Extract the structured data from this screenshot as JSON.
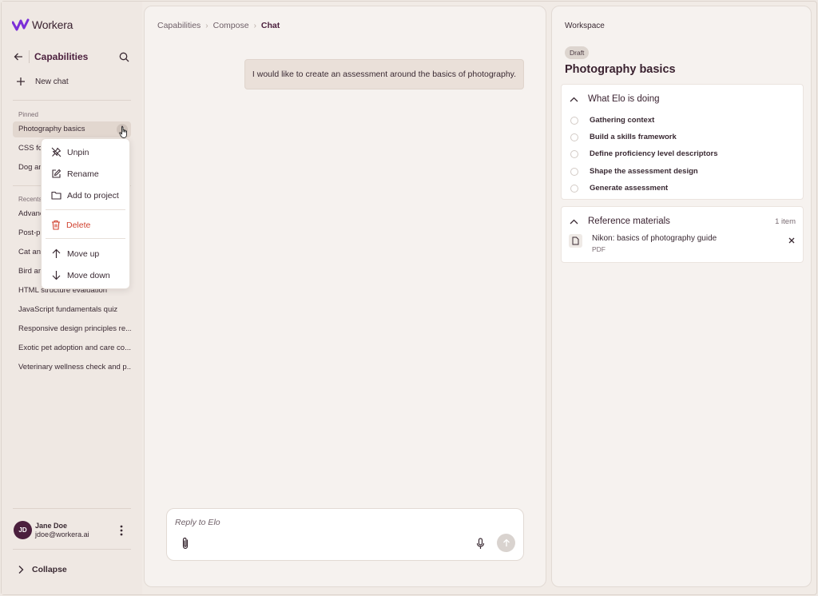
{
  "app": {
    "brand": "Workera"
  },
  "sidebar": {
    "title": "Capabilities",
    "new_chat": "New chat",
    "pinned_label": "Pinned",
    "pinned": [
      {
        "label": "Photography basics"
      },
      {
        "label": "CSS fou"
      },
      {
        "label": "Dog an"
      }
    ],
    "recents_label": "Recents",
    "recents": [
      {
        "label": "Advanc"
      },
      {
        "label": "Post-pr"
      },
      {
        "label": "Cat and"
      },
      {
        "label": "Bird an"
      },
      {
        "label": "HTML structure evaluation"
      },
      {
        "label": "JavaScript fundamentals quiz"
      },
      {
        "label": "Responsive design principles re..."
      },
      {
        "label": "Exotic pet adoption and care co..."
      },
      {
        "label": "Veterinary wellness check and p..."
      }
    ],
    "user": {
      "initials": "JD",
      "name": "Jane Doe",
      "email": "jdoe@workera.ai"
    },
    "collapse": "Collapse"
  },
  "context_menu": {
    "unpin": "Unpin",
    "rename": "Rename",
    "add_to_project": "Add to project",
    "delete": "Delete",
    "move_up": "Move up",
    "move_down": "Move down"
  },
  "main": {
    "breadcrumbs": [
      "Capabilities",
      "Compose",
      "Chat"
    ],
    "message": "I would like to create an assessment around the basics of photography.",
    "composer_placeholder": "Reply to Elo"
  },
  "workspace": {
    "label": "Workspace",
    "badge": "Draft",
    "title": "Photography basics",
    "doing": {
      "heading": "What Elo is doing",
      "steps": [
        "Gathering context",
        "Build a skills framework",
        "Define proficiency level descriptors",
        "Shape the assessment design",
        "Generate assessment"
      ]
    },
    "references": {
      "heading": "Reference materials",
      "count": "1 item",
      "items": [
        {
          "name": "Nikon: basics of photography guide",
          "type": "PDF"
        }
      ]
    }
  },
  "colors": {
    "brand": "#4b1f3d",
    "danger": "#d0402e",
    "logo": "#7b2fd8"
  }
}
